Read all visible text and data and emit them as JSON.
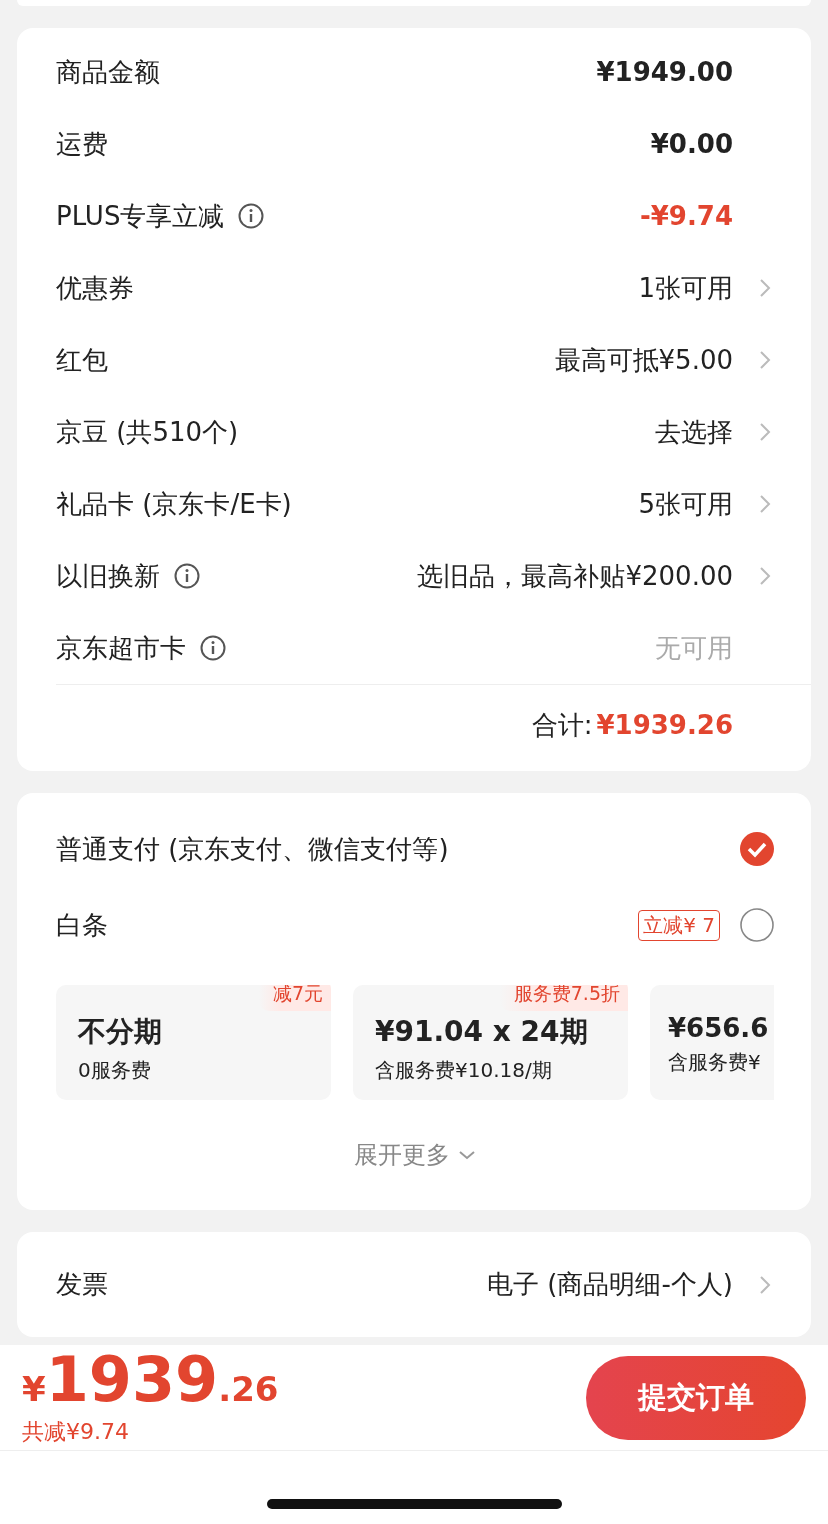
{
  "summary": {
    "rows": [
      {
        "label": "商品金额",
        "info": false,
        "value": "¥1949.00",
        "kind": "amount",
        "arrow": false
      },
      {
        "label": "运费",
        "info": false,
        "value": "¥0.00",
        "kind": "amount",
        "arrow": false
      },
      {
        "label": "PLUS专享立减",
        "info": true,
        "value": "-¥9.74",
        "kind": "discount",
        "arrow": false
      },
      {
        "label": "优惠券",
        "info": false,
        "value": "1张可用",
        "kind": "plain",
        "arrow": true
      },
      {
        "label": "红包",
        "info": false,
        "value": "最高可抵¥5.00",
        "kind": "plain",
        "arrow": true
      },
      {
        "label": "京豆 (共510个)",
        "info": false,
        "value": "去选择",
        "kind": "plain",
        "arrow": true
      },
      {
        "label": "礼品卡 (京东卡/E卡)",
        "info": false,
        "value": "5张可用",
        "kind": "plain",
        "arrow": true
      },
      {
        "label": "以旧换新",
        "info": true,
        "value": "选旧品，最高补贴¥200.00",
        "kind": "plain",
        "arrow": true
      },
      {
        "label": "京东超市卡",
        "info": true,
        "value": "无可用",
        "kind": "muted",
        "arrow": false
      }
    ],
    "total_label": "合计:",
    "total_value": "¥1939.26"
  },
  "payment": {
    "options": [
      {
        "label": "普通支付 (京东支付、微信支付等)",
        "selected": true
      },
      {
        "label": "白条",
        "badge": "立减¥ 7",
        "selected": false
      }
    ],
    "plans": [
      {
        "title": "不分期",
        "subtitle": "0服务费",
        "tag": "减7元"
      },
      {
        "title": "¥91.04 x 24期",
        "subtitle": "含服务费¥10.18/期",
        "tag": "服务费7.5折"
      },
      {
        "title": "¥656.6",
        "subtitle": "含服务费¥"
      }
    ],
    "expand": "展开更多"
  },
  "invoice": {
    "label": "发票",
    "value": "电子 (商品明细-个人)"
  },
  "bottom_bar": {
    "currency": "¥",
    "integer": "1939",
    "decimal": ".26",
    "saving": "共减¥9.74",
    "submit": "提交订单"
  }
}
